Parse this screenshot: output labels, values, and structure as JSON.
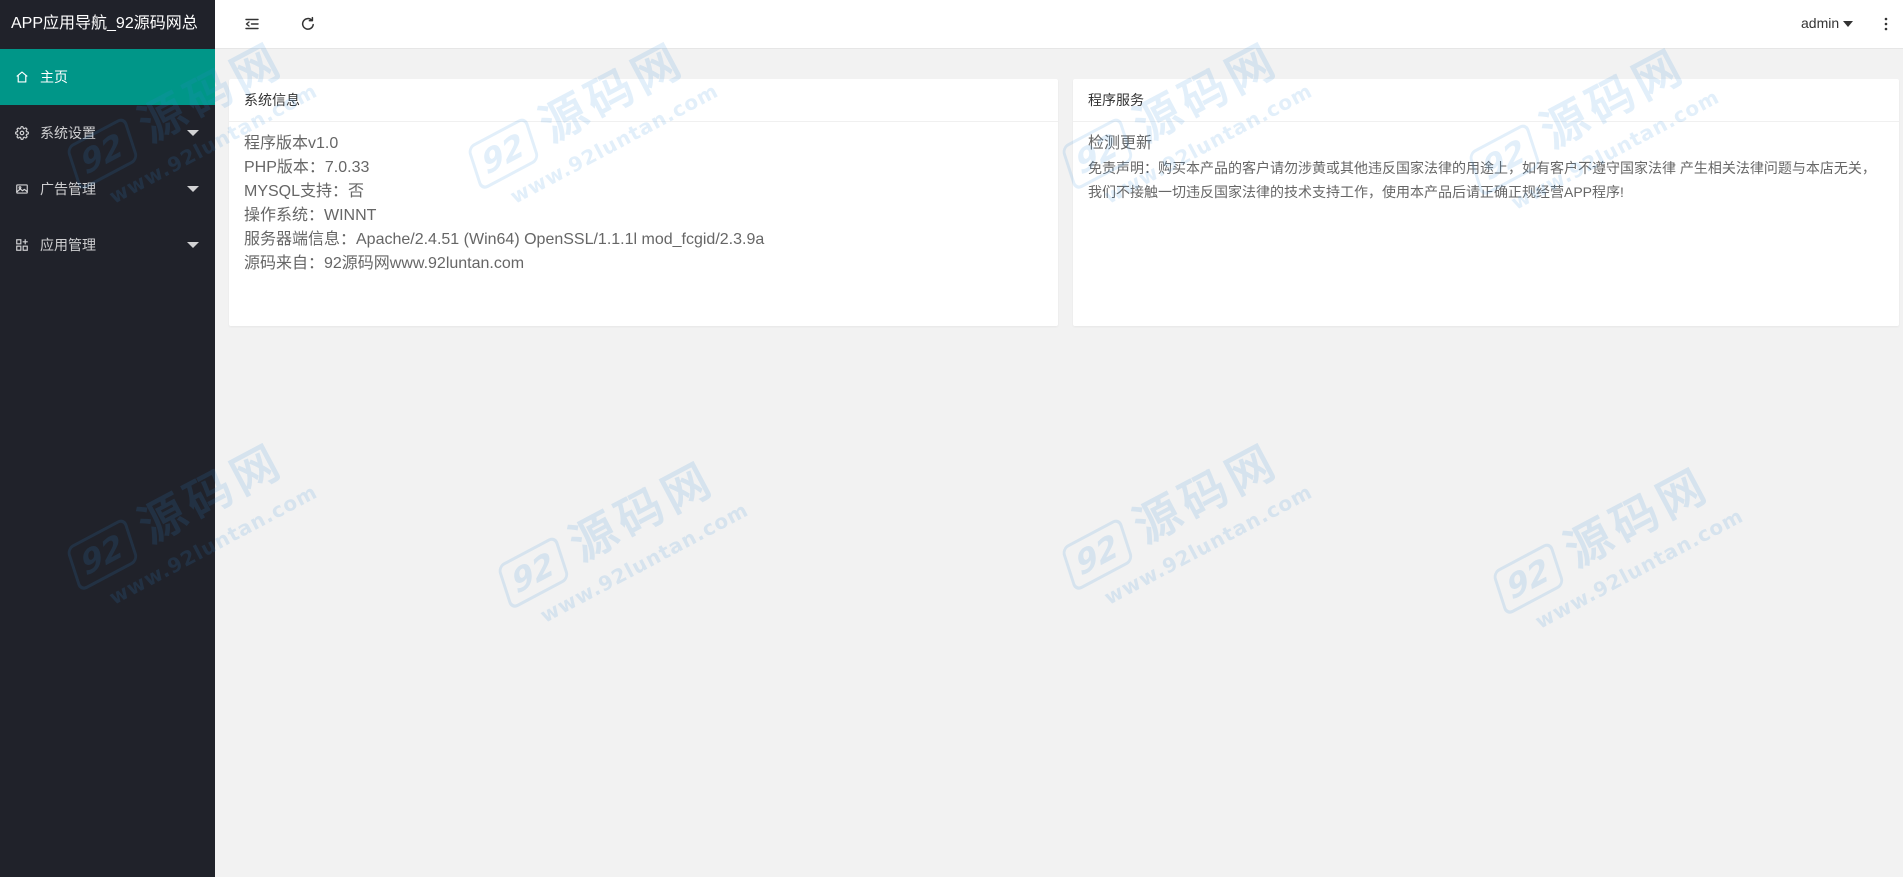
{
  "app": {
    "title": "APP应用导航_92源码网总"
  },
  "sidebar": {
    "items": [
      {
        "label": "主页",
        "icon": "home-icon",
        "active": true
      },
      {
        "label": "系统设置",
        "icon": "gear-icon",
        "has_children": true
      },
      {
        "label": "广告管理",
        "icon": "image-icon",
        "has_children": true
      },
      {
        "label": "应用管理",
        "icon": "app-grid-icon",
        "has_children": true
      }
    ]
  },
  "header": {
    "shrink_icon": "indent-icon",
    "refresh_icon": "refresh-icon",
    "user": "admin",
    "user_caret_icon": "caret-down-icon",
    "more_icon": "more-vertical-icon"
  },
  "cards": [
    {
      "title": "系统信息",
      "lines": [
        "程序版本v1.0",
        "PHP版本：7.0.33",
        "MYSQL支持：否",
        "操作系统：WINNT",
        "服务器端信息：Apache/2.4.51 (Win64) OpenSSL/1.1.1l mod_fcgid/2.3.9a",
        "源码来自：92源码网www.92luntan.com"
      ]
    },
    {
      "title": "程序服务",
      "link": "检测更新",
      "disclaimer": "免责声明：购买本产品的客户请勿涉黄或其他违反国家法律的用途上，如有客户不遵守国家法律 产生相关法律问题与本店无关，我们不接触一切违反国家法律的技术支持工作，使用本产品后请正确正规经营APP程序!"
    }
  ],
  "watermark": {
    "badge": "92",
    "title": "源码网",
    "url": "www.92luntan.com"
  },
  "colors": {
    "sidebar_bg": "#20222a",
    "accent": "#009688",
    "content_bg": "#f2f2f2",
    "card_bg": "#ffffff"
  }
}
